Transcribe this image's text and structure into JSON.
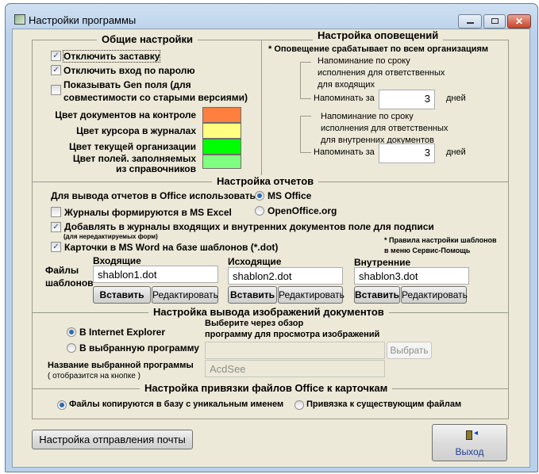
{
  "window": {
    "title": "Настройки программы"
  },
  "general": {
    "title": "Общие настройки",
    "checkboxes": [
      {
        "label": "Отключить заставку",
        "checked": true
      },
      {
        "label": "Отключить вход по паролю",
        "checked": true
      },
      {
        "label1": "Показывать Gen поля (для",
        "label2": "совместимости со старыми версиями)",
        "checked": false
      }
    ],
    "colors": [
      {
        "label": "Цвет документов на контроле",
        "color": "#ff7f3f"
      },
      {
        "label": "Цвет курсора в журналах",
        "color": "#ffff80"
      },
      {
        "label": "Цвет текущей организации",
        "color": "#00ff00"
      },
      {
        "label1": "Цвет полей. заполняемых",
        "label2": "из справочников",
        "color": "#80ff80"
      }
    ]
  },
  "notify": {
    "title": "Настройка оповещений",
    "note": "* Оповещение срабатывает по всем организациям",
    "groups": [
      {
        "l1": "Напоминание по сроку",
        "l2": "исполнения для ответственных",
        "l3": "для входящих",
        "remind": "Напоминать за",
        "value": "3",
        "unit": "дней"
      },
      {
        "l1": "Напоминание по сроку",
        "l2": "исполнения для ответственных",
        "l3": "для внутренних документов",
        "remind": "Напоминать за",
        "value": "3",
        "unit": "дней"
      }
    ]
  },
  "reports": {
    "title": "Настройка отчетов",
    "office_label": "Для вывода отчетов в Office использовать",
    "ms_office": "MS Office",
    "open_office": "OpenOffice.org",
    "excel": "Журналы формируются в MS Excel",
    "sign": "Добавлять в журналы входящих и внутренних документов поле для подписи",
    "sign_note": "(для нередактируемых форм)",
    "word": "Карточки в MS Word на базе шаблонов (*.dot)",
    "rules1": "* Правила настройки шаблонов",
    "rules2": "в меню Сервис-Помощь",
    "files1": "Файлы",
    "files2": "шаблонов",
    "templates": [
      {
        "label": "Входящие",
        "value": "shablon1.dot"
      },
      {
        "label": "Исходящие",
        "value": "shablon2.dot"
      },
      {
        "label": "Внутренние",
        "value": "shablon3.dot"
      }
    ],
    "insert": "Вставить",
    "edit": "Редактировать"
  },
  "images": {
    "title": "Настройка вывода изображений документов",
    "ie": "В Internet Explorer",
    "custom": "В выбранную программу",
    "choose1": "Выберите через обзор",
    "choose2": "программу для просмотра изображений",
    "path": "",
    "browse": "Выбрать",
    "name1": "Название выбранной программы",
    "name2": "( отобразится на кнопке )",
    "name_value": "AcdSee"
  },
  "binding": {
    "title": "Настройка привязки файлов Office к карточкам",
    "unique": "Файлы копируются в базу с уникальным именем",
    "existing": "Привязка к существующим файлам"
  },
  "footer": {
    "mail": "Настройка отправления почты",
    "exit": "Выход"
  }
}
